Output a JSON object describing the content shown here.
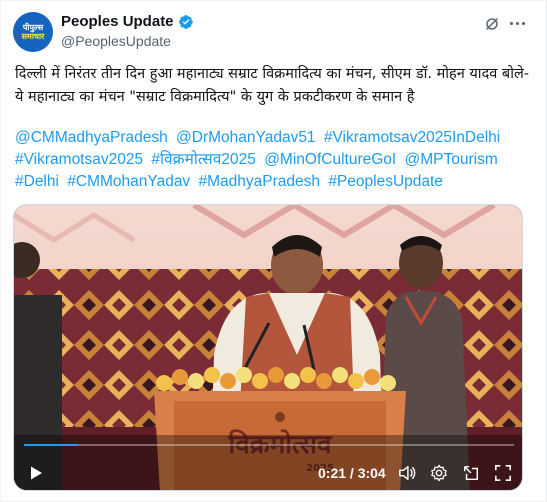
{
  "account": {
    "name": "Peoples Update",
    "handle": "@PeoplesUpdate",
    "avatar_line1": "पीपुल्स",
    "avatar_line2": "समाचार",
    "verified": true
  },
  "post": {
    "text": "दिल्ली में निरंतर तीन दिन हुआ महानाट्य सम्राट विक्रमादित्य का मंचन, सीएम डॉ. मोहन यादव बोले- ये महानाट्य का मंचन \"सम्राट विक्रमादित्य\" के युग के प्रकटीकरण के समान है",
    "hashtags": [
      "@CMMadhyaPradesh",
      "@DrMohanYadav51",
      "#Vikramotsav2025InDelhi",
      "#Vikramotsav2025",
      "#विक्रमोत्सव2025",
      "@MinOfCultureGoI",
      "@MPTourism",
      "#Delhi",
      "#CMMohanYadav",
      "#MadhyaPradesh",
      "#PeoplesUpdate"
    ]
  },
  "video": {
    "current_time": "0:21",
    "duration": "3:04",
    "time_display": "0:21 / 3:04",
    "progress": 0.11,
    "podium_text": "विक्रमोत्सव",
    "podium_year": "2025"
  },
  "icons": {
    "verified": "verified-badge-icon",
    "grok": "grok-icon",
    "more": "more-icon",
    "play": "play-icon",
    "volume": "volume-icon",
    "settings": "settings-icon",
    "expand": "expand-icon",
    "fullscreen": "fullscreen-icon"
  },
  "colors": {
    "link": "#1d9bf0",
    "verified": "#1d9bf0",
    "handle": "#536471",
    "text": "#0f1419"
  }
}
